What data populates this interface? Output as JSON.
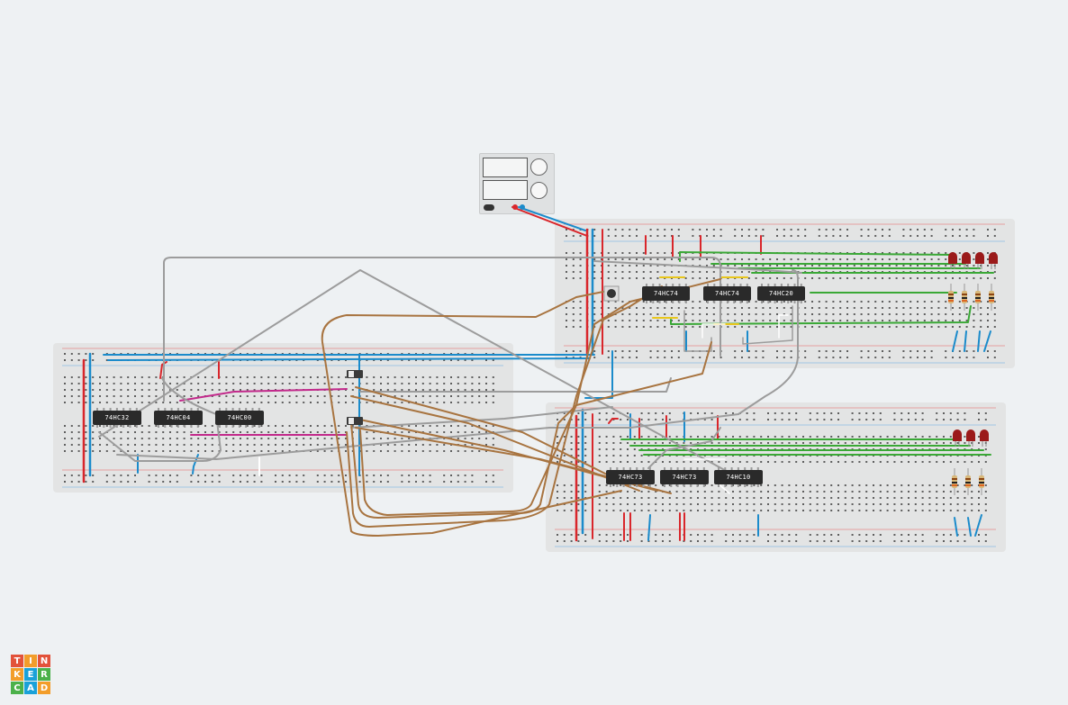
{
  "chips": {
    "board_right": [
      "74HC74",
      "74HC74",
      "74HC20"
    ],
    "board_left": [
      "74HC32",
      "74HC04",
      "74HC00"
    ],
    "board_bottom": [
      "74HC73",
      "74HC73",
      "74HC10"
    ]
  },
  "logo": {
    "letters": [
      "T",
      "I",
      "N",
      "K",
      "E",
      "R",
      "C",
      "A",
      "D"
    ],
    "colors": [
      "#e2523a",
      "#f29d2a",
      "#e2523a",
      "#f29d2a",
      "#1aa1d8",
      "#4bb14a",
      "#4bb14a",
      "#1aa1d8",
      "#f29d2a"
    ]
  },
  "colors": {
    "wire_red": "#d9262b",
    "wire_blue": "#1b8bcb",
    "wire_gray": "#9c9c9c",
    "wire_brown": "#a87440",
    "wire_green": "#3aa836",
    "wire_magenta": "#c2298b",
    "wire_yellow": "#e8c61c",
    "led": "#9b1a1a"
  }
}
